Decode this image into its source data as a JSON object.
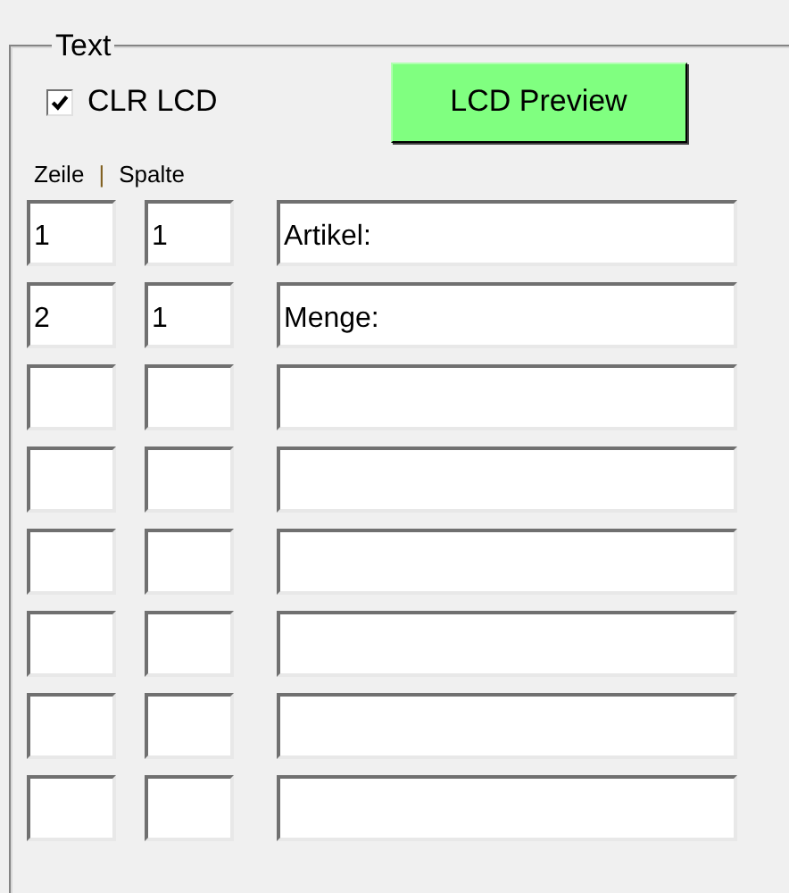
{
  "group": {
    "title": "Text"
  },
  "clear_checkbox": {
    "label": "CLR LCD",
    "checked": true
  },
  "preview_button": {
    "label": "LCD Preview"
  },
  "headers": {
    "row": "Zeile",
    "separator": "|",
    "column": "Spalte"
  },
  "rows": [
    {
      "zeile": "1",
      "spalte": "1",
      "text": "Artikel:"
    },
    {
      "zeile": "2",
      "spalte": "1",
      "text": "Menge:"
    },
    {},
    {},
    {},
    {},
    {},
    {}
  ]
}
